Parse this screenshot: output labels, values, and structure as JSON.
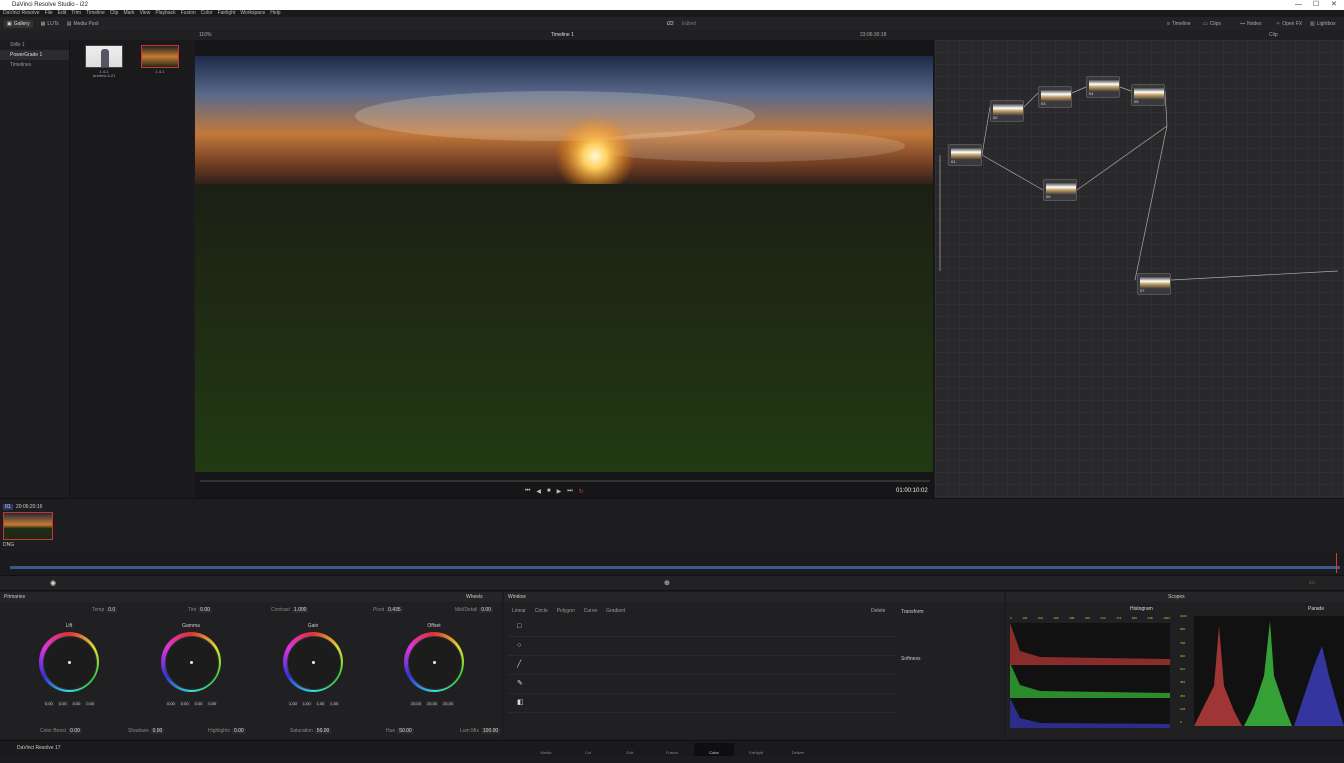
{
  "app": {
    "title": "DaVinci Resolve Studio - i22",
    "name": "DaVinci Resolve 17"
  },
  "menu": [
    "DaVinci Resolve",
    "File",
    "Edit",
    "Trim",
    "Timeline",
    "Clip",
    "Mark",
    "View",
    "Playback",
    "Fusion",
    "Color",
    "Fairlight",
    "Workspace",
    "Help"
  ],
  "topbar": {
    "gallery": "Gallery",
    "luts": "LUTs",
    "media_pool": "Media Pool",
    "project": "i22",
    "status": "Edited",
    "timeline": "Timeline",
    "clips": "Clips",
    "nodes": "Nodes",
    "open_fx": "Open FX",
    "lightbox": "Lightbox"
  },
  "viewerbar": {
    "zoom": "110%",
    "timeline_name": "Timeline 1",
    "timecode": "23:06:30:18",
    "mode": "Clip"
  },
  "sidebar": [
    "Stills 1",
    "PowerGrade 1",
    "Timelines"
  ],
  "stills": [
    {
      "label": "1.4.1",
      "sub": "Andrew 4-21"
    },
    {
      "label": "1.4.1",
      "sub": ""
    }
  ],
  "viewer": {
    "timecode": "01:00:10:02"
  },
  "nodes": [
    "01",
    "02",
    "03",
    "04",
    "05",
    "06",
    "07"
  ],
  "clip": {
    "index": "01",
    "timecode": "20:06:20:16",
    "format": "DNG"
  },
  "primaries": {
    "title": "Primaries",
    "mode": "Wheels",
    "temp_label": "Temp",
    "temp": "0.0",
    "tint_label": "Tint",
    "tint": "0.00",
    "contrast_label": "Contrast",
    "contrast": "1.000",
    "pivot_label": "Pivot",
    "pivot": "0.435",
    "middetail_label": "Mid/Detail",
    "middetail": "0.00",
    "wheels": [
      {
        "name": "Lift",
        "vals": [
          "0.00",
          "0.00",
          "0.00",
          "0.00"
        ]
      },
      {
        "name": "Gamma",
        "vals": [
          "0.00",
          "0.00",
          "0.00",
          "0.00"
        ]
      },
      {
        "name": "Gain",
        "vals": [
          "1.00",
          "1.00",
          "1.00",
          "1.00"
        ]
      },
      {
        "name": "Offset",
        "vals": [
          "25.00",
          "25.00",
          "25.00"
        ]
      }
    ],
    "colorboost_label": "Color Boost",
    "colorboost": "0.00",
    "shadows_label": "Shadows",
    "shadows": "0.00",
    "highlights_label": "Highlights",
    "highlights": "0.00",
    "saturation_label": "Saturation",
    "saturation": "50.00",
    "hue_label": "Hue",
    "hue": "50.00",
    "lummix_label": "Lum Mix",
    "lummix": "100.00"
  },
  "window": {
    "title": "Window",
    "tools": [
      "Linear",
      "Circle",
      "Polygon",
      "Curve",
      "Gradient"
    ],
    "delete": "Delete",
    "transform": "Transform",
    "softness": "Softness"
  },
  "scopes": {
    "title": "Scopes",
    "mode": "Histogram",
    "mode2": "Parade",
    "hist_ticks": [
      "0",
      "102",
      "204",
      "306",
      "408",
      "510",
      "612",
      "714",
      "816",
      "918",
      "1023"
    ],
    "parade_ticks": [
      "1023",
      "896",
      "768",
      "640",
      "512",
      "384",
      "256",
      "128",
      "0"
    ]
  },
  "pages": [
    "Media",
    "Cut",
    "Edit",
    "Fusion",
    "Color",
    "Fairlight",
    "Deliver"
  ]
}
